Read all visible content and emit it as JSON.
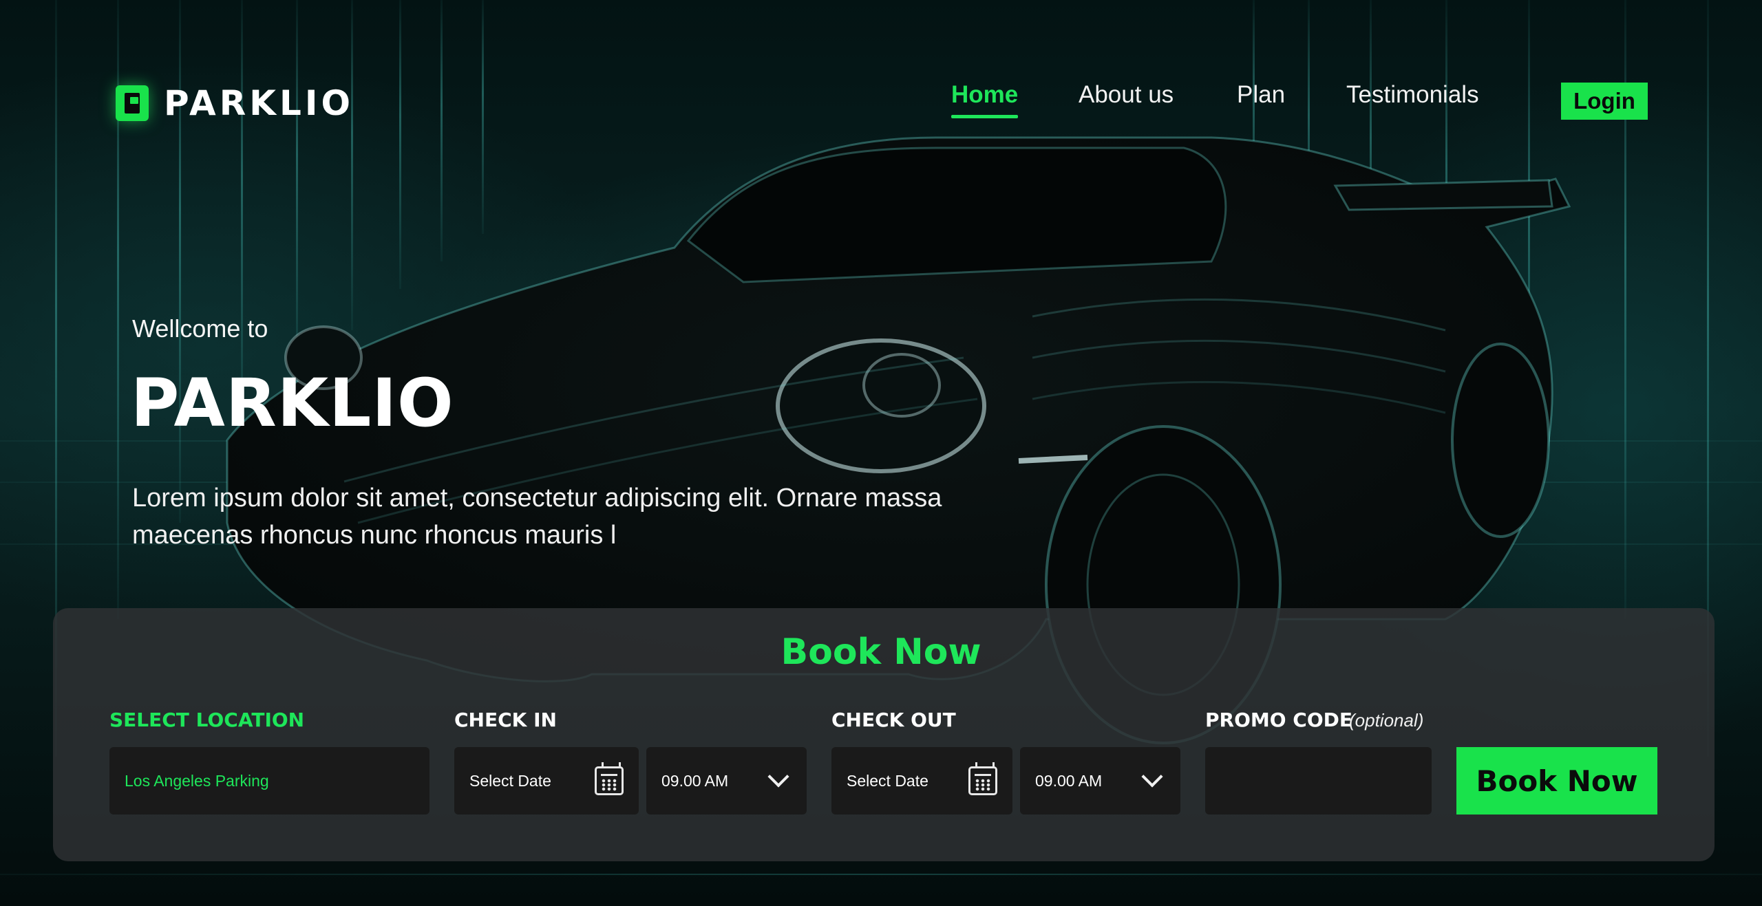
{
  "brand": {
    "name": "PARKLIO",
    "logo_icon": "parking-p-icon",
    "accent": "#1ee65a"
  },
  "nav": {
    "items": [
      {
        "label": "Home",
        "active": true
      },
      {
        "label": "About us",
        "active": false
      },
      {
        "label": "Plan",
        "active": false
      },
      {
        "label": "Testimonials",
        "active": false
      }
    ],
    "login_label": "Login"
  },
  "hero": {
    "eyebrow": "Wellcome to",
    "title": "PARKLIO",
    "description": "Lorem ipsum dolor sit amet, consectetur adipiscing elit. Ornare massa maecenas rhoncus nunc rhoncus mauris l"
  },
  "booking": {
    "title": "Book Now",
    "location": {
      "label": "SELECT LOCATION",
      "value": "Los Angeles Parking"
    },
    "check_in": {
      "label": "CHECK IN",
      "date_placeholder": "Select Date",
      "time": "09.00 AM"
    },
    "check_out": {
      "label": "CHECK OUT",
      "date_placeholder": "Select Date",
      "time": "09.00 AM"
    },
    "promo": {
      "label": "PROMO CODE",
      "hint": "(optional)",
      "value": ""
    },
    "submit_label": "Book Now"
  }
}
